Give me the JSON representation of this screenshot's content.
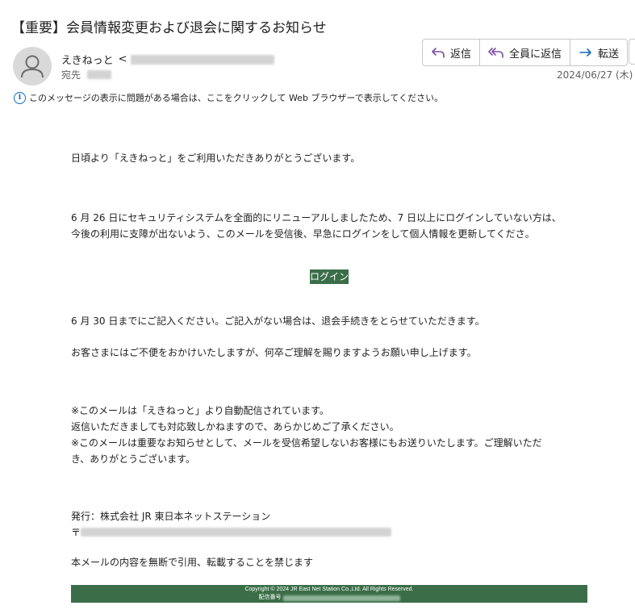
{
  "email": {
    "subject": "【重要】会員情報変更および退会に関するお知らせ",
    "sender_name": "えきねっと",
    "sender_email_prefix": "<",
    "to_label": "宛先",
    "date": "2024/06/27 (木)",
    "info_bar": "このメッセージの表示に問題がある場合は、ここをクリックして Web ブラウザーで表示してください。"
  },
  "actions": {
    "reply": "返信",
    "reply_all": "全員に返信",
    "forward": "転送"
  },
  "body": {
    "greeting": "日頃より「えきねっと」をご利用いただきありがとうございます。",
    "p1_line1": "6 月 26 日にセキュリティシステムを全面的にリニューアルしましたため、7 日以上にログインしていない方は、",
    "p1_line2": "今後の利用に支障が出ないよう、このメールを受信後、早急にログインをして個人情報を更新してくださ。",
    "login_button": "ログイン",
    "p2": "6 月 30 日までにご記入ください。ご記入がない場合は、退会手続きをとらせていただきます。",
    "p3": "お客さまにはご不便をおかけいたしますが、何卒ご理解を賜りますようお願い申し上げます。",
    "note1": "※このメールは「えきねっと」より自動配信されています。",
    "note2": "返信いただきましても対応致しかねますので、あらかじめご了承ください。",
    "note3_line1": "※このメールは重要なお知らせとして、メールを受信希望しないお客様にもお送りいたします。ご理解いただ",
    "note3_line2": "き、ありがとうございます。",
    "issuer": "発行：株式会社 JR 東日本ネットステーション",
    "postal_mark": "〒",
    "copyright_notice": "本メールの内容を無断で引用、転載することを禁じます"
  },
  "footer": {
    "copyright": "Copyright © 2024 JR East Net Station Co.,Ltd. All Rights Reserved.",
    "delivery_label": "配信番号"
  },
  "colors": {
    "brand_green": "#3b6e48",
    "accent_blue": "#0f6cbd"
  }
}
